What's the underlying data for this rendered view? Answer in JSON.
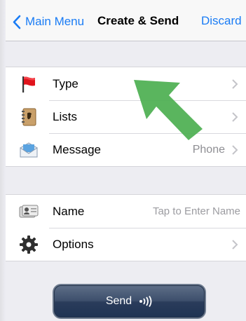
{
  "nav": {
    "back_label": "Main Menu",
    "title": "Create & Send",
    "discard_label": "Discard"
  },
  "groups": [
    {
      "rows": [
        {
          "label": "Type",
          "icon": "red-flag-icon",
          "detail": "",
          "has_chevron": true
        },
        {
          "label": "Lists",
          "icon": "address-book-icon",
          "detail": "",
          "has_chevron": true
        },
        {
          "label": "Message",
          "icon": "envelope-icon",
          "detail": "Phone",
          "has_chevron": true
        }
      ]
    },
    {
      "rows": [
        {
          "label": "Name",
          "icon": "id-card-icon",
          "detail": "Tap to Enter Name",
          "has_chevron": false
        },
        {
          "label": "Options",
          "icon": "gear-icon",
          "detail": "",
          "has_chevron": true
        }
      ]
    }
  ],
  "send_button": {
    "label": "Send",
    "icon": "broadcast-icon"
  },
  "annotation": {
    "icon": "green-arrow-icon",
    "color": "#4caf50"
  },
  "colors": {
    "accent": "#1a7cf5",
    "background": "#ededf2",
    "send_button": "#2a3c5b"
  }
}
